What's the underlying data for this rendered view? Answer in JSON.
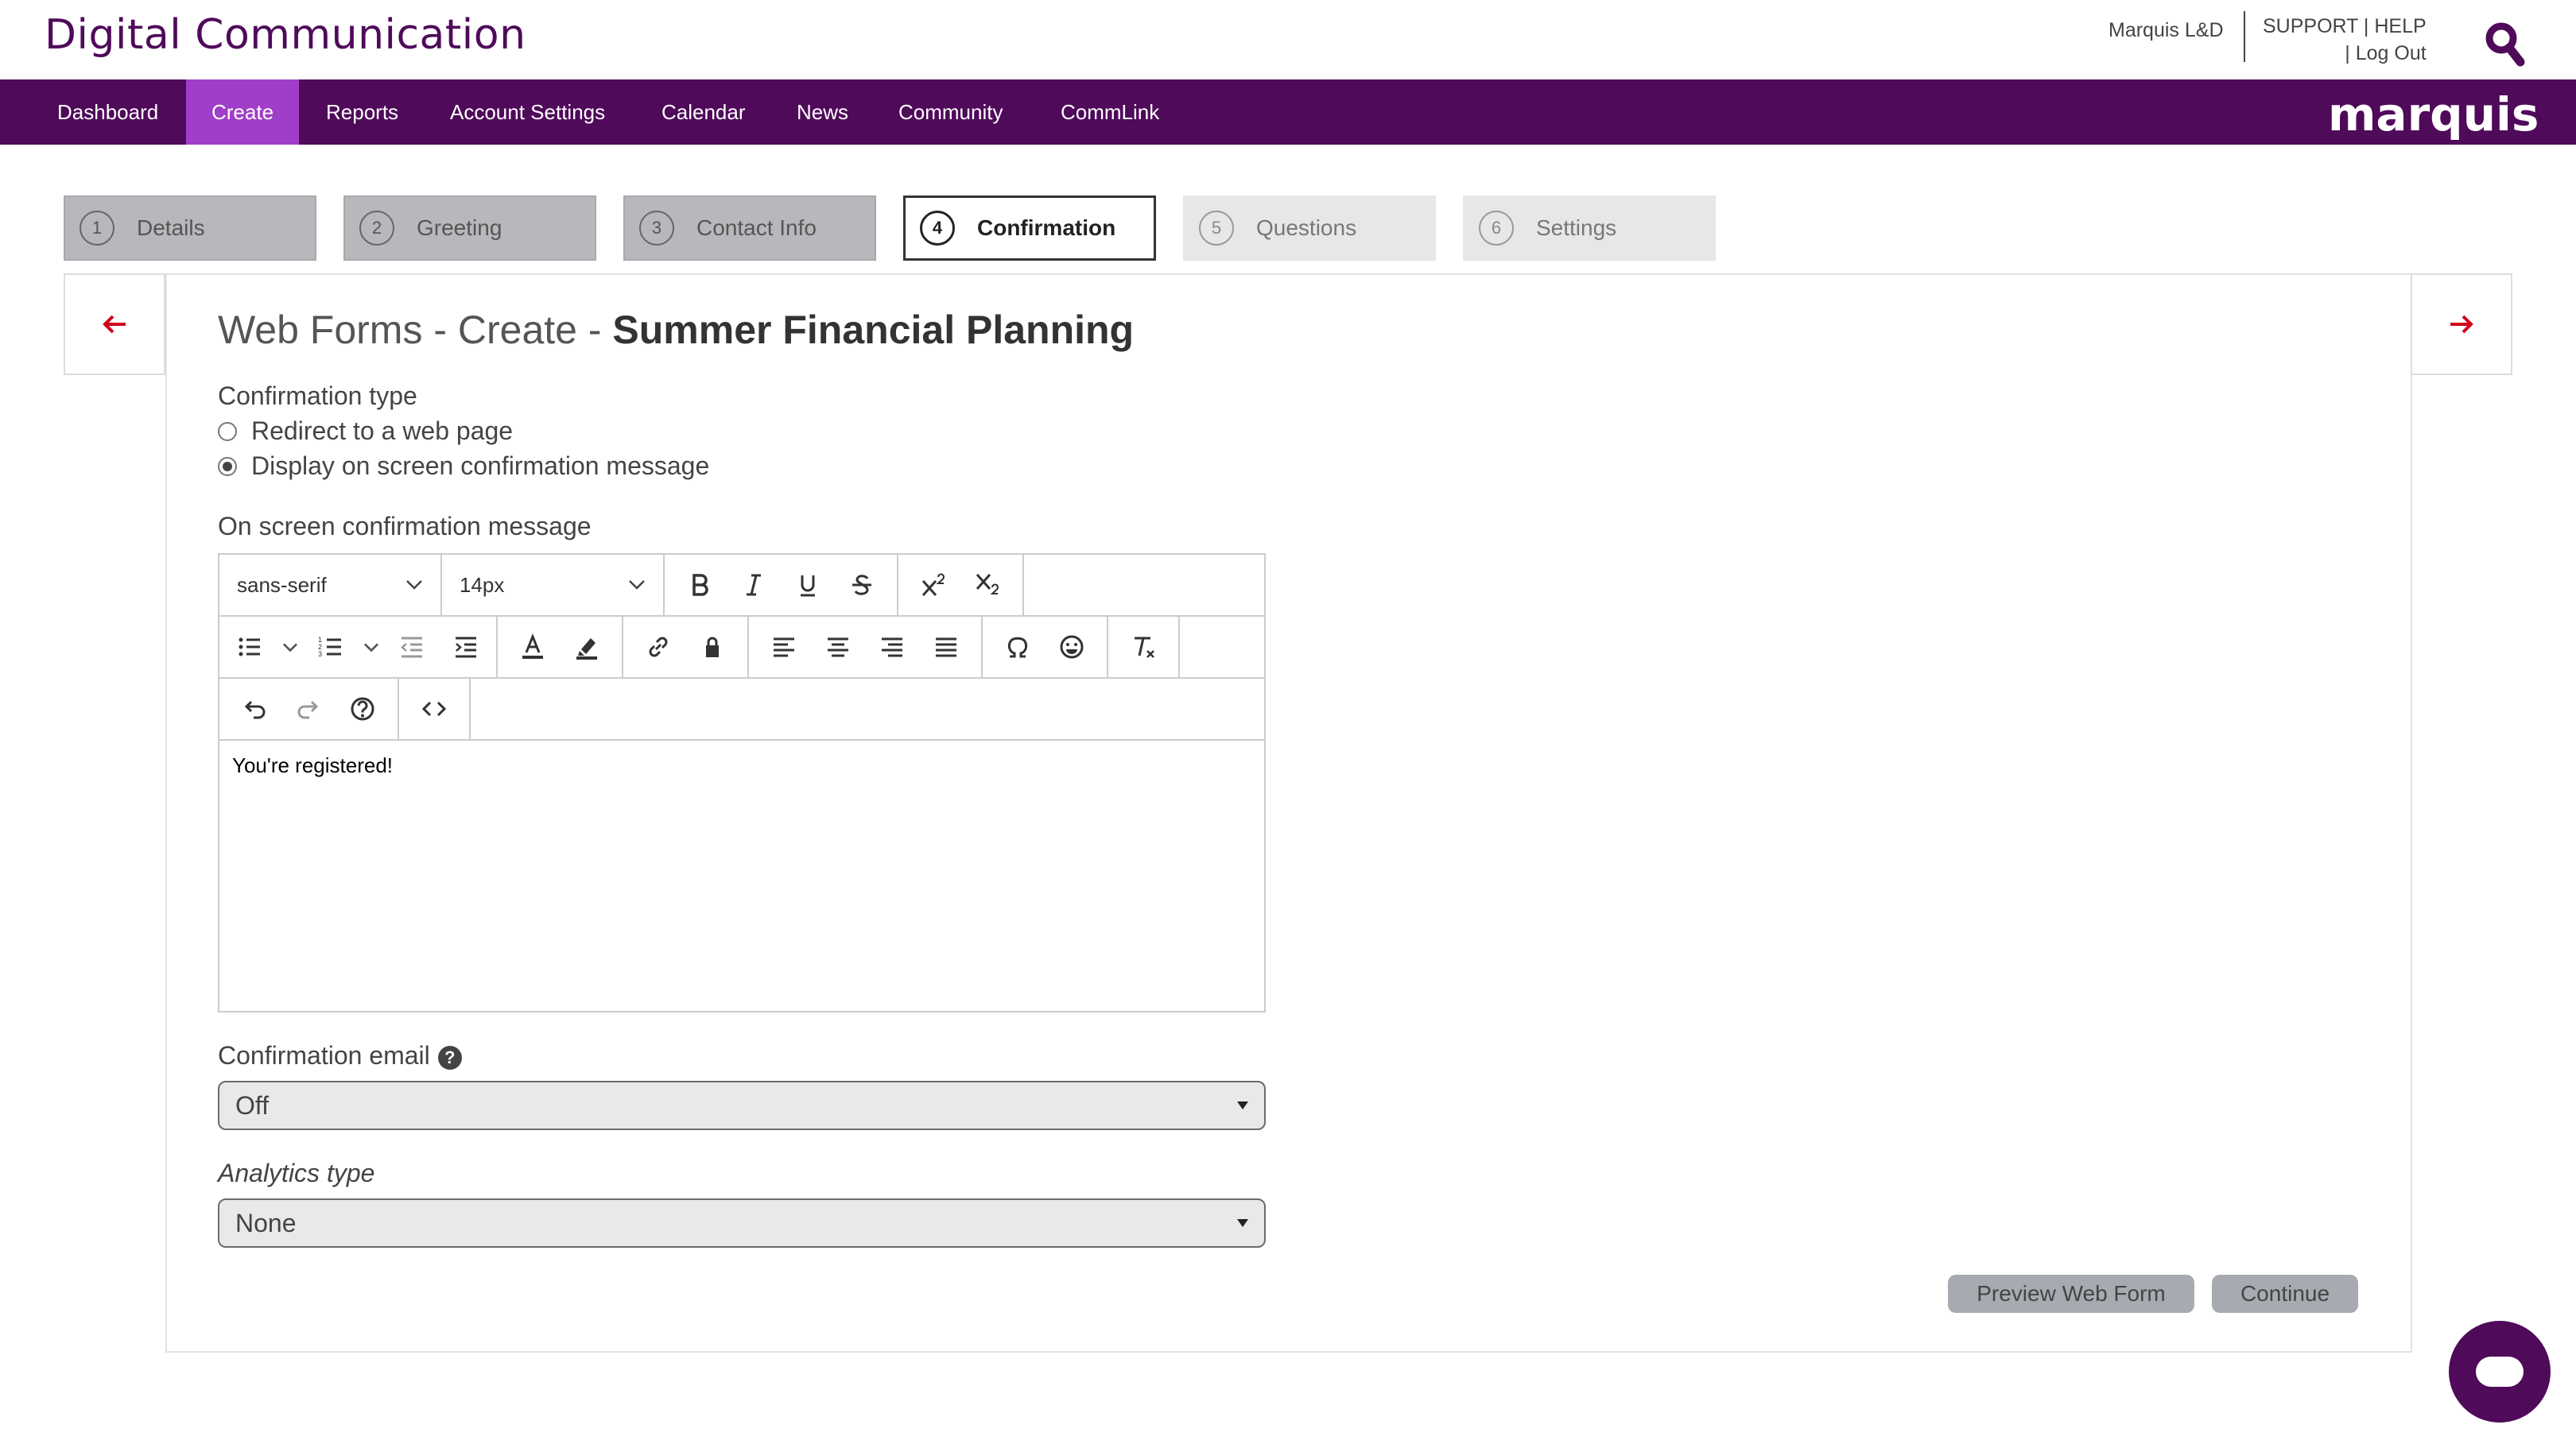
{
  "header": {
    "brand": "Digital Communication",
    "user": "Marquis L&D",
    "support": "SUPPORT",
    "sep1": "|",
    "help": "HELP",
    "sep2": "|",
    "logout": "Log Out"
  },
  "nav": {
    "items": [
      "Dashboard",
      "Create",
      "Reports",
      "Account Settings",
      "Calendar",
      "News",
      "Community",
      "CommLink"
    ],
    "active": "Create",
    "logo": "marquis"
  },
  "steps": [
    {
      "num": "1",
      "label": "Details",
      "state": "done"
    },
    {
      "num": "2",
      "label": "Greeting",
      "state": "done"
    },
    {
      "num": "3",
      "label": "Contact Info",
      "state": "done"
    },
    {
      "num": "4",
      "label": "Confirmation",
      "state": "current"
    },
    {
      "num": "5",
      "label": "Questions",
      "state": "future"
    },
    {
      "num": "6",
      "label": "Settings",
      "state": "future"
    }
  ],
  "page": {
    "title_prefix": "Web Forms - Create -",
    "title_name": "Summer Financial Planning"
  },
  "form": {
    "confirmation_type_label": "Confirmation type",
    "radio_redirect": "Redirect to a web page",
    "radio_display": "Display on screen confirmation message",
    "selected_radio": "Display on screen confirmation message",
    "message_label": "On screen confirmation message",
    "font_family": "sans-serif",
    "font_size": "14px",
    "message_content": "You're registered!",
    "confirmation_email_label": "Confirmation email",
    "confirmation_email_value": "Off",
    "analytics_label": "Analytics type",
    "analytics_value": "None"
  },
  "actions": {
    "preview": "Preview Web Form",
    "continue": "Continue"
  },
  "colors": {
    "brand_purple": "#4f0a5a",
    "active_nav": "#a13ec9",
    "arrow_red": "#d0021b"
  }
}
